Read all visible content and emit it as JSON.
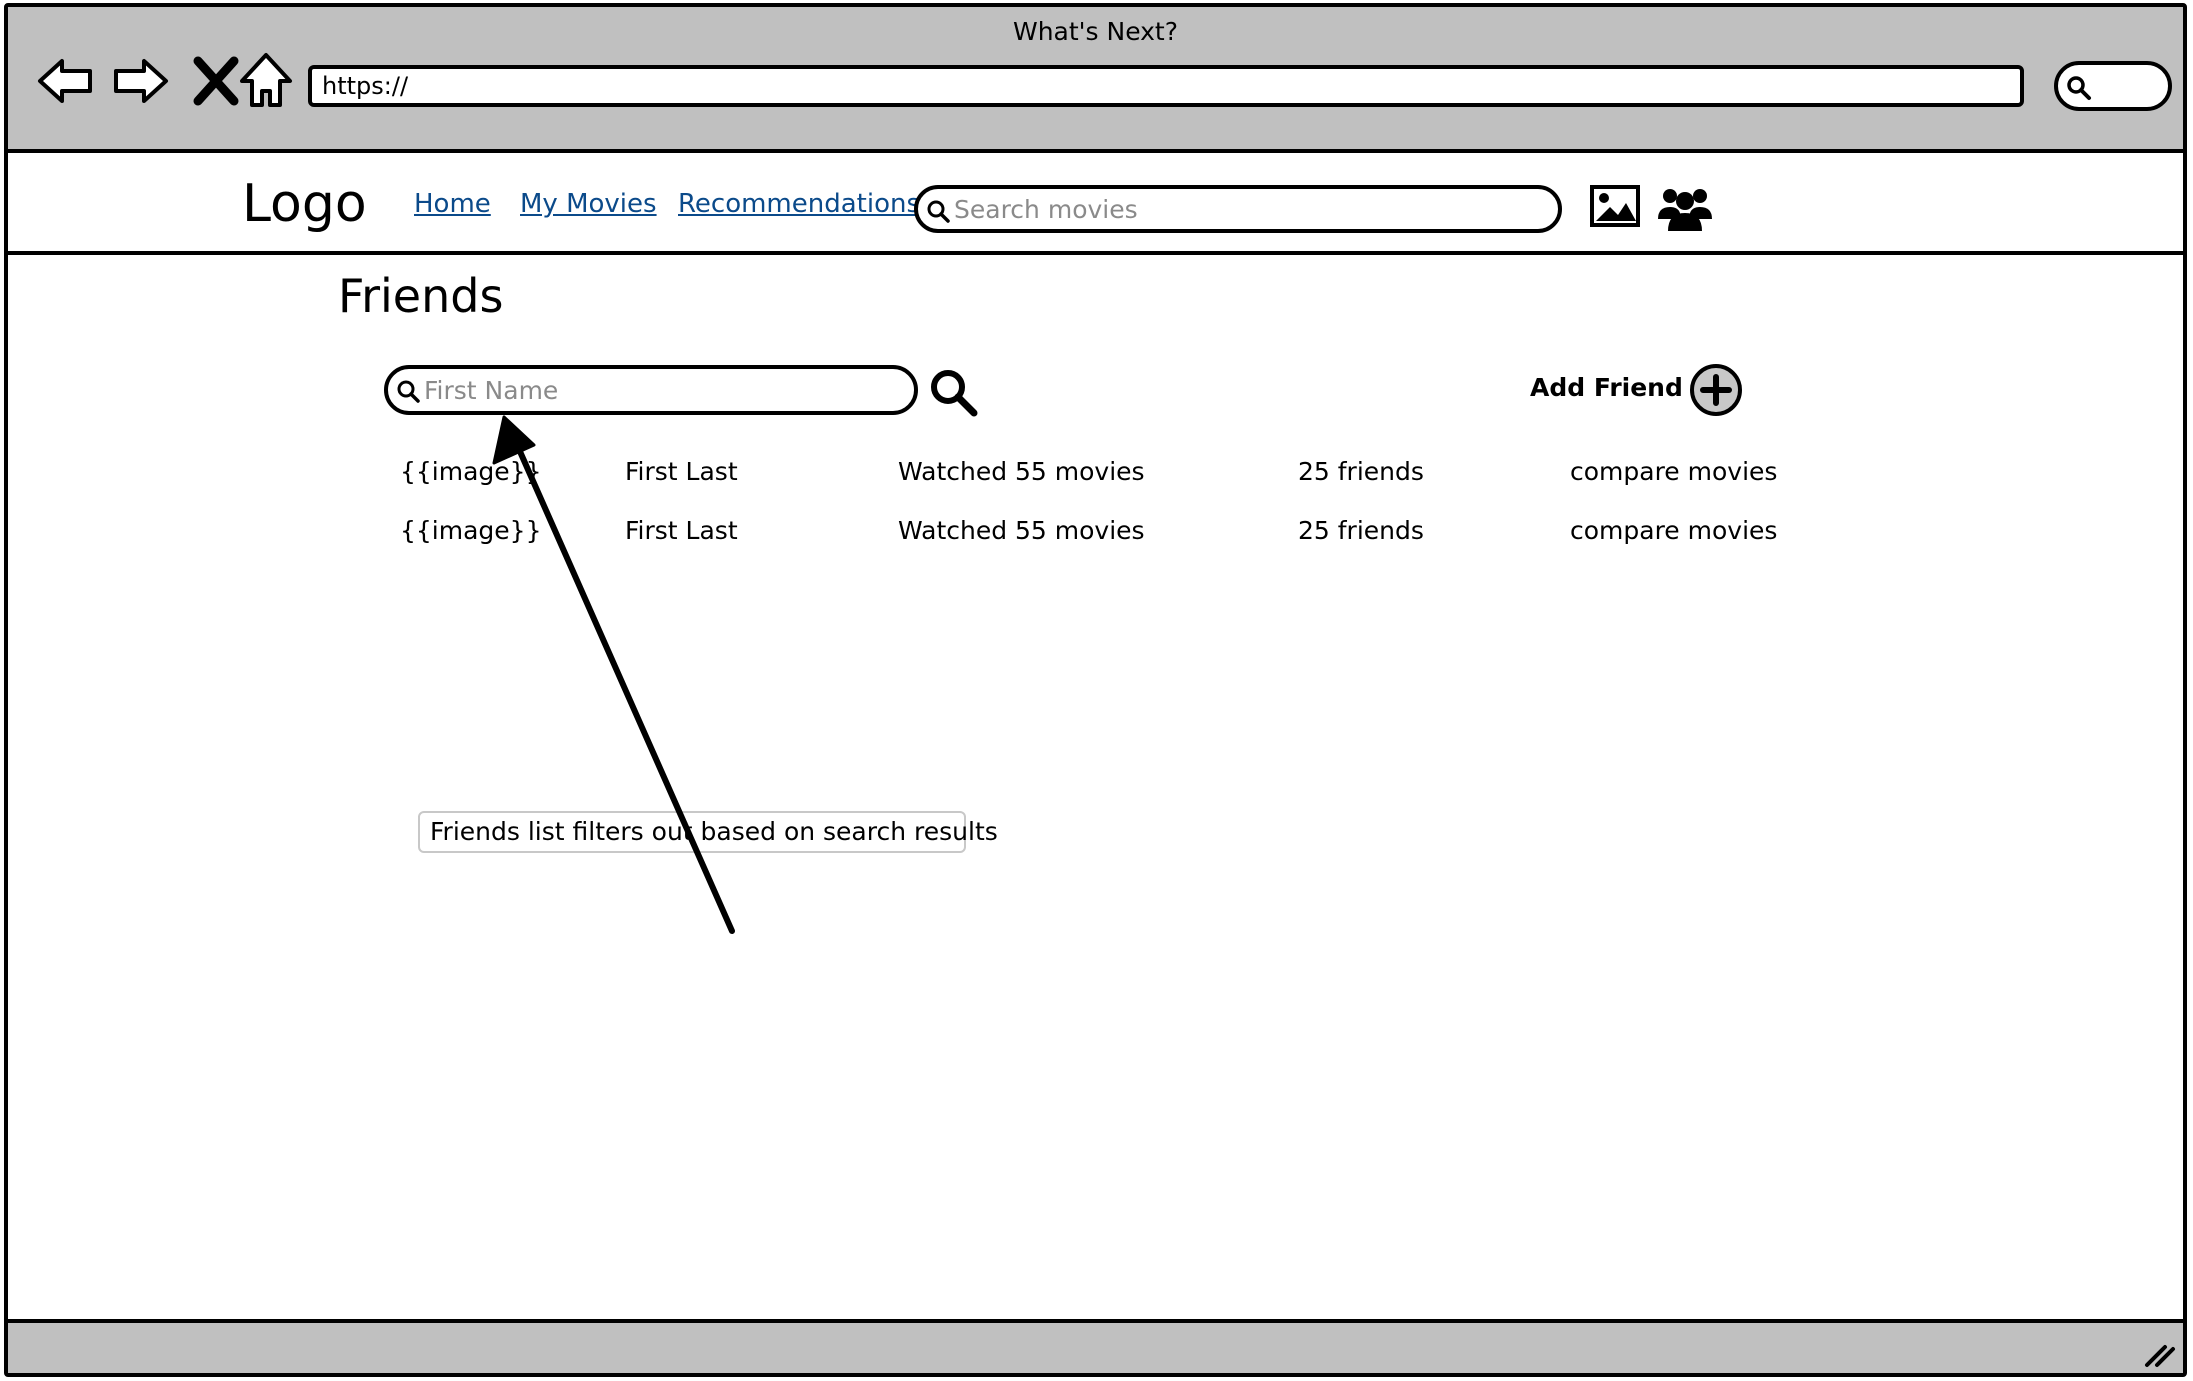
{
  "window": {
    "title": "What's Next?"
  },
  "browser": {
    "url": "https://",
    "nav_icons": [
      "back-arrow-icon",
      "forward-arrow-icon",
      "stop-icon",
      "home-icon"
    ]
  },
  "header": {
    "logo": "Logo",
    "links": [
      "Home",
      "My Movies",
      "Recommendations"
    ],
    "search_placeholder": "Search movies"
  },
  "page": {
    "title": "Friends",
    "search_placeholder": "First Name",
    "add_friend_label": "Add Friend"
  },
  "friends": [
    {
      "image": "{{image}}",
      "name": "First Last",
      "watched": "Watched 55 movies",
      "friends": "25 friends",
      "action": "compare movies"
    },
    {
      "image": "{{image}}",
      "name": "First Last",
      "watched": "Watched 55 movies",
      "friends": "25 friends",
      "action": "compare movies"
    }
  ],
  "annotation": {
    "text": "Friends list filters out based on search results"
  },
  "colors": {
    "chrome": "#c0c0c0",
    "link": "#0b4a8a"
  }
}
